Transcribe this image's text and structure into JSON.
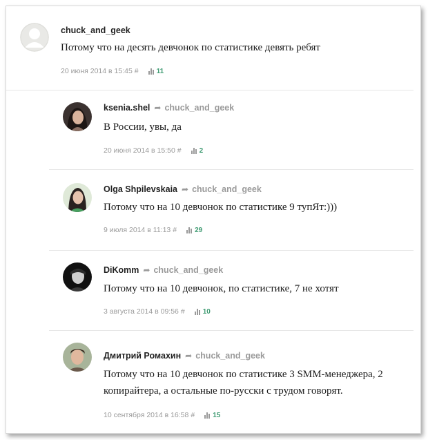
{
  "comments": [
    {
      "author": "chuck_and_geek",
      "reply_to": "",
      "text": "Потому что на десять девчонок по статистике девять ребят",
      "date": "20 июня 2014 в 15:45",
      "hash": "#",
      "votes": "11",
      "avatar": "default-avatar-icon"
    },
    {
      "author": "ksenia.shel",
      "reply_to": "chuck_and_geek",
      "text": "В России, увы, да",
      "date": "20 июня 2014 в 15:50",
      "hash": "#",
      "votes": "2",
      "avatar": "user-photo"
    },
    {
      "author": "Olga Shpilevskaia",
      "reply_to": "chuck_and_geek",
      "text": "Потому что на 10 девчонок по статистике 9 тупЯт:)))",
      "date": "9 июля 2014 в 11:13",
      "hash": "#",
      "votes": "29",
      "avatar": "user-photo"
    },
    {
      "author": "DiKomm",
      "reply_to": "chuck_and_geek",
      "text": "Потому что на 10 девчонок, по статистике, 7 не хотят",
      "date": "3 августа 2014 в 09:56",
      "hash": "#",
      "votes": "10",
      "avatar": "user-photo"
    },
    {
      "author": "Дмитрий Ромахин",
      "reply_to": "chuck_and_geek",
      "text_line1": "Потому что на 10 девчонок по статистике 3 SMM-менеджера, 2",
      "text_line2": "копирайтера, а остальные по-русски с трудом говорят.",
      "date": "10 сентября 2014 в 16:58",
      "hash": "#",
      "votes": "15",
      "avatar": "user-photo"
    }
  ],
  "reply_arrow": "➦",
  "colors": {
    "votes": "#3f9b72",
    "meta": "#9a9a9a",
    "divider": "#e6e6e6"
  }
}
